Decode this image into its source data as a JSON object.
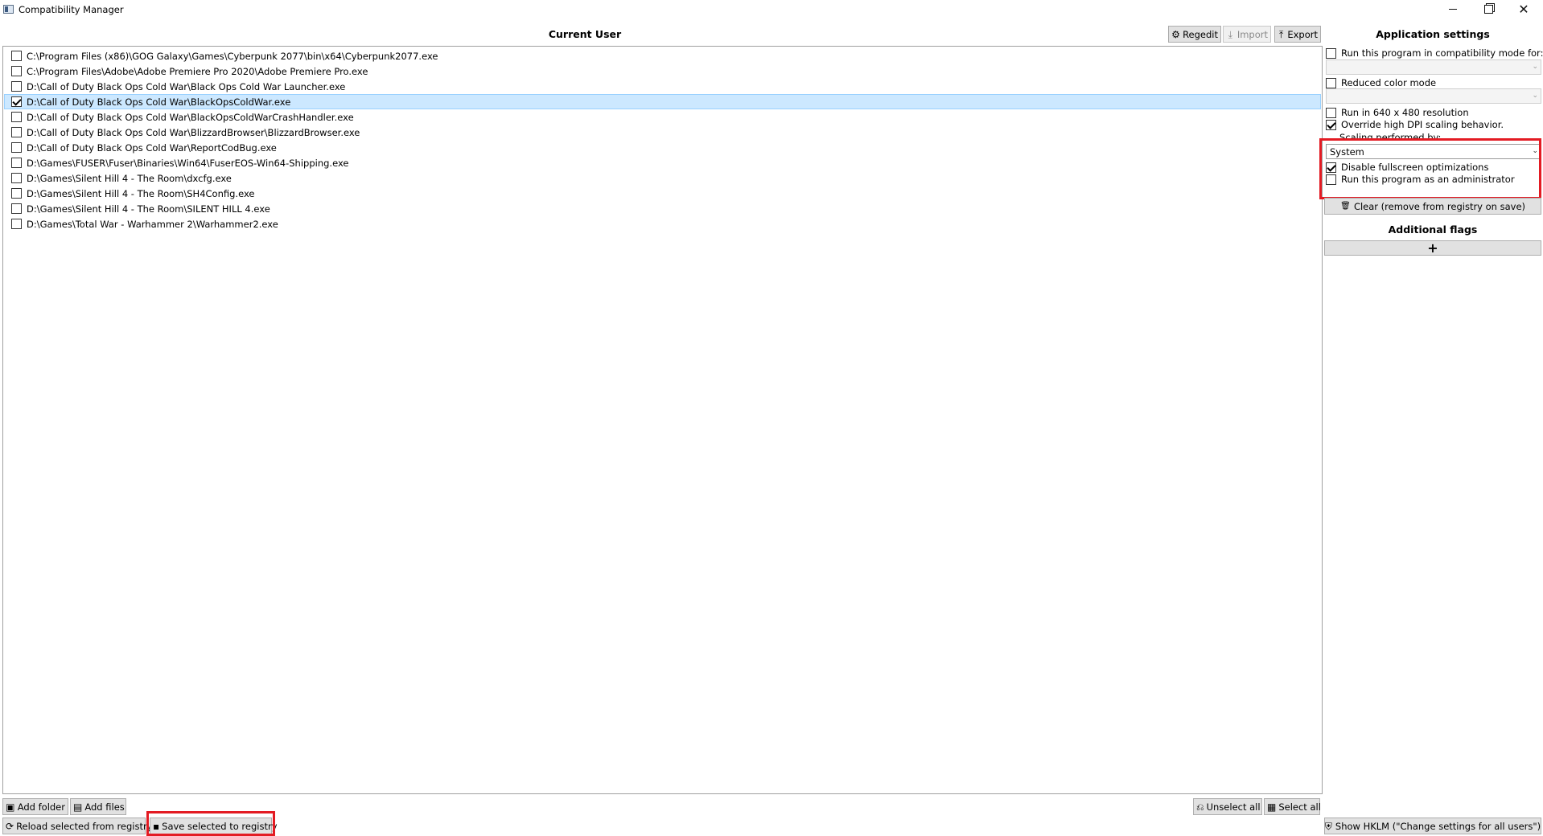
{
  "window": {
    "title": "Compatibility Manager",
    "minimize_glyph": "",
    "maximize_glyph": "",
    "close_glyph": "✕"
  },
  "left_panel": {
    "title": "Current User",
    "toolbar": {
      "regedit_label": "Regedit",
      "import_label": "Import",
      "export_label": "Export"
    },
    "files": [
      {
        "path": "C:\\Program Files (x86)\\GOG Galaxy\\Games\\Cyberpunk 2077\\bin\\x64\\Cyberpunk2077.exe",
        "checked": false,
        "selected": false
      },
      {
        "path": "C:\\Program Files\\Adobe\\Adobe Premiere Pro 2020\\Adobe Premiere Pro.exe",
        "checked": false,
        "selected": false
      },
      {
        "path": "D:\\Call of Duty Black Ops Cold War\\Black Ops Cold War Launcher.exe",
        "checked": false,
        "selected": false
      },
      {
        "path": "D:\\Call of Duty Black Ops Cold War\\BlackOpsColdWar.exe",
        "checked": true,
        "selected": true
      },
      {
        "path": "D:\\Call of Duty Black Ops Cold War\\BlackOpsColdWarCrashHandler.exe",
        "checked": false,
        "selected": false
      },
      {
        "path": "D:\\Call of Duty Black Ops Cold War\\BlizzardBrowser\\BlizzardBrowser.exe",
        "checked": false,
        "selected": false
      },
      {
        "path": "D:\\Call of Duty Black Ops Cold War\\ReportCodBug.exe",
        "checked": false,
        "selected": false
      },
      {
        "path": "D:\\Games\\FUSER\\Fuser\\Binaries\\Win64\\FuserEOS-Win64-Shipping.exe",
        "checked": false,
        "selected": false
      },
      {
        "path": "D:\\Games\\Silent Hill 4 - The Room\\dxcfg.exe",
        "checked": false,
        "selected": false
      },
      {
        "path": "D:\\Games\\Silent Hill 4 - The Room\\SH4Config.exe",
        "checked": false,
        "selected": false
      },
      {
        "path": "D:\\Games\\Silent Hill 4 - The Room\\SILENT HILL 4.exe",
        "checked": false,
        "selected": false
      },
      {
        "path": "D:\\Games\\Total War - Warhammer 2\\Warhammer2.exe",
        "checked": false,
        "selected": false
      }
    ],
    "bottom": {
      "add_folder_label": "Add folder",
      "add_files_label": "Add files",
      "reload_label": "Reload selected from registry",
      "save_label": "Save selected to registry",
      "unselect_all_label": "Unselect all",
      "select_all_label": "Select all"
    }
  },
  "right_panel": {
    "title": "Application settings",
    "compat_mode_label": "Run this program in compatibility mode for:",
    "compat_mode_checked": false,
    "reduced_color_label": "Reduced color mode",
    "reduced_color_checked": false,
    "run_640_label": "Run in 640 x 480 resolution",
    "run_640_checked": false,
    "override_dpi_label": "Override high DPI scaling behavior.",
    "override_dpi_checked": true,
    "scaling_label": "Scaling performed by:",
    "scaling_value": "System",
    "disable_fullscreen_label": "Disable fullscreen optimizations",
    "disable_fullscreen_checked": true,
    "run_admin_label": "Run this program as an administrator",
    "run_admin_checked": false,
    "clear_label": "Clear (remove from registry on save)",
    "additional_flags_title": "Additional flags",
    "add_flag_glyph": "+",
    "hklm_label": "Show HKLM (\"Change settings for all users\")"
  },
  "icons": {
    "gear": "⚙",
    "import": "⤓",
    "export": "⤒",
    "folder": "▣",
    "files": "▤",
    "reload": "⟳",
    "save": "▪",
    "unselect": "⎌",
    "select": "▦",
    "trash": "🗑",
    "shield": "⛨",
    "chevron": "⌄"
  },
  "colors": {
    "selection_bg": "#cce8ff",
    "selection_border": "#99d1ff",
    "highlight_red": "#e31b23",
    "button_bg": "#e1e1e1"
  }
}
